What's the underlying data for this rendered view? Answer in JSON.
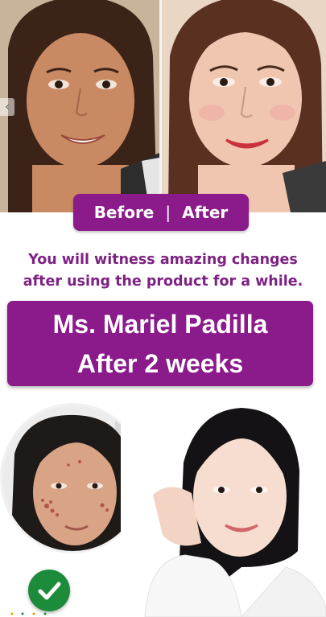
{
  "comparison": {
    "before_label": "Before",
    "separator": "|",
    "after_label": "After"
  },
  "headline": {
    "line1": "You will witness amazing changes",
    "line2": "after using the product for a while."
  },
  "testimonial": {
    "name": "Ms. Mariel Padilla",
    "duration": "After 2 weeks"
  },
  "icons": {
    "prev": "chevron-left-icon",
    "arrow": "curved-arrow-icon",
    "check": "check-circle-icon"
  },
  "colors": {
    "brand_purple": "#8b1a8b",
    "headline_purple": "#7d2283",
    "check_green": "#1c8b3a"
  }
}
